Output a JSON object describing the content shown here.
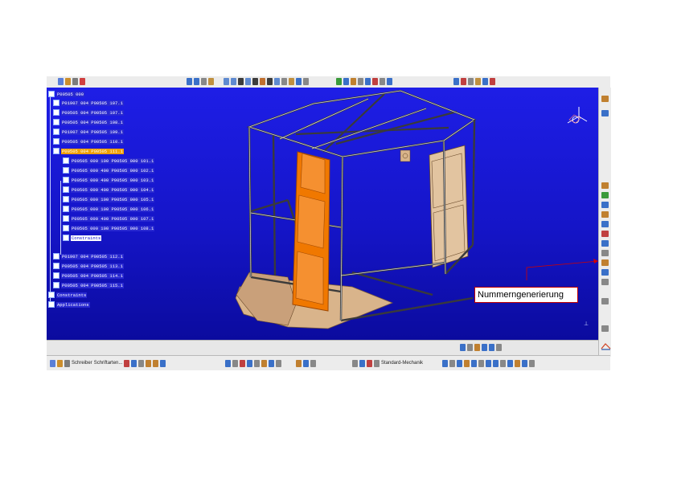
{
  "tree": {
    "items": [
      {
        "label": "P00505 000",
        "level": 0,
        "state": "normal"
      },
      {
        "label": "P01907 004 P00505 107.1",
        "level": 1,
        "state": "normal"
      },
      {
        "label": "P00505 004 P00505 107.1",
        "level": 1,
        "state": "normal"
      },
      {
        "label": "P00505 004 P00505 108.1",
        "level": 1,
        "state": "normal"
      },
      {
        "label": "P01907 004 P00505 109.1",
        "level": 1,
        "state": "normal"
      },
      {
        "label": "P00505 004 P00505 110.1",
        "level": 1,
        "state": "normal"
      },
      {
        "label": "P00505 004 P00505 111.1",
        "level": 1,
        "state": "selected"
      },
      {
        "label": "P00505 000 100 P00505 000 101.1",
        "level": 2,
        "state": "normal"
      },
      {
        "label": "P00505 000 400 P00505 000 102.1",
        "level": 2,
        "state": "normal"
      },
      {
        "label": "P00505 000 400 P00505 000 103.1",
        "level": 2,
        "state": "normal"
      },
      {
        "label": "P00505 000 400 P00505 000 104.1",
        "level": 2,
        "state": "normal"
      },
      {
        "label": "P00505 000 100 P00505 000 105.1",
        "level": 2,
        "state": "normal"
      },
      {
        "label": "P00505 000 100 P00505 000 106.1",
        "level": 2,
        "state": "normal"
      },
      {
        "label": "P00505 000 400 P00505 000 107.1",
        "level": 2,
        "state": "normal"
      },
      {
        "label": "P00505 000 100 P00505 000 108.1",
        "level": 2,
        "state": "normal"
      },
      {
        "label": "Constraints",
        "level": 2,
        "state": "blank"
      },
      {
        "label": "P01907 004 P00505 112.1",
        "level": 1,
        "state": "normal"
      },
      {
        "label": "P00505 004 P00505 113.1",
        "level": 1,
        "state": "normal"
      },
      {
        "label": "P00505 004 P00505 114.1",
        "level": 1,
        "state": "normal"
      },
      {
        "label": "P00505 004 P00505 115.1",
        "level": 1,
        "state": "normal"
      },
      {
        "label": "Constraints",
        "level": 0,
        "state": "normal"
      },
      {
        "label": "Applications",
        "level": 0,
        "state": "normal"
      }
    ]
  },
  "callout": {
    "text": "Nummerngenerierung"
  },
  "bottom_toolbar": {
    "select_label_1": "Schreiber",
    "select_label_2": "Schriftarten...",
    "select_label_3": "Standard-Mechanik"
  },
  "colors": {
    "viewport_top": "#1e1ee6",
    "viewport_bottom": "#0b0b9e",
    "selection": "#f0a000",
    "callout_border": "#c00000",
    "model_body": "#d9b48b",
    "model_door": "#f07800"
  },
  "icons": {
    "compass": "compass-icon",
    "catia_logo": "catia-logo-icon"
  }
}
